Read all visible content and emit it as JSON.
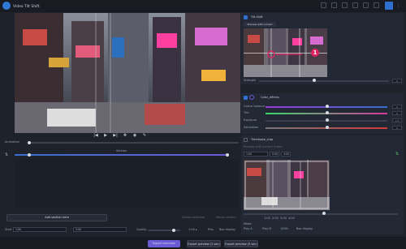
{
  "app": {
    "title": "Video Tilt Shift",
    "logo_icon": "app-logo-icon"
  },
  "colors": {
    "accent": "#2f6fd0",
    "purple": "#6b5bd6",
    "pink": "#e0235f",
    "panel": "#232835",
    "bg": "#1e222b"
  },
  "playback": {
    "prev_label": "|◀",
    "play_label": "▶",
    "next_label": "▶|",
    "seek_label": "Animation"
  },
  "timeline": {
    "section_label": "Section",
    "add_section_label": "Add section here",
    "extra_left": "Delete selection",
    "extra_right": "Merge section"
  },
  "bottom_controls": {
    "start_label": "Start",
    "start_value": "1:00",
    "end_value": "3:00",
    "quality_label": "Quality",
    "quality_value": "1:00 ▸",
    "option_a": "Plus",
    "option_b": "Box display"
  },
  "tilt_panel": {
    "title": "Tilt-Shift",
    "preview_label": "Preview with current frame",
    "strength_label": "Strength",
    "strength_value": "0",
    "pin_number": "1"
  },
  "color_panel": {
    "title": "Color_effects",
    "rows": [
      {
        "label": "Colour balance",
        "value": "0"
      },
      {
        "label": "Tint",
        "value": "0"
      },
      {
        "label": "Exposure",
        "value": "0.0"
      },
      {
        "label": "Saturation",
        "value": "0"
      }
    ]
  },
  "timewarp_panel": {
    "title": "Timelapse_crop",
    "preview_label": "Preview with current frame",
    "fields": [
      "1:00",
      "0:00",
      "4:00"
    ],
    "ticks": [
      "1:00",
      "2:00",
      "3:00",
      "4:00"
    ],
    "info_a": "Mode",
    "info_b": "Play A",
    "info_c": "Play B",
    "info_d": "100%",
    "info_e": "Box display"
  },
  "footer": {
    "export_selection": "Export selection",
    "export_preview_a": "Export preview (1 sec)",
    "export_preview_b": "Export preview (5 sec)"
  }
}
